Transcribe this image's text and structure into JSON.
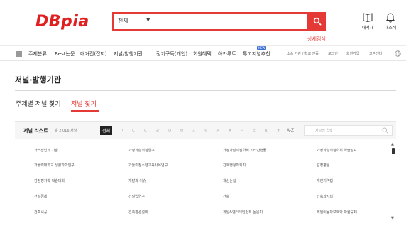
{
  "header": {
    "logo": "DBpia",
    "search": {
      "scope": "전체",
      "placeholder": ""
    },
    "advanced_search": "상세검색",
    "utils": [
      {
        "icon": "book-icon",
        "label": "내서재"
      },
      {
        "icon": "bell-icon",
        "label": "내소식"
      }
    ]
  },
  "nav": {
    "items": [
      "주제분류",
      "Best논문",
      "매거진(잡지)",
      "저널/발행기관",
      "정기구독(개인)",
      "회원혜택",
      "아카루트",
      "투고저널추천"
    ],
    "new_badge": "NEW",
    "small_links": [
      "소속 기관 / 학교 인증",
      "로그인",
      "회원가입",
      "고객센터"
    ]
  },
  "page": {
    "title": "저널·발행기관",
    "tabs": [
      "주제별 저널 찾기",
      "저널 찾기"
    ]
  },
  "journal_list": {
    "title": "저널 리스트",
    "count": "총 2,016 저널",
    "filters": [
      "전체",
      "ㄱ",
      "ㄴ",
      "ㄷ",
      "ㄹ",
      "ㅁ",
      "ㅂ",
      "ㅅ",
      "ㅇ",
      "ㅈ",
      "ㅊ",
      "ㅋ",
      "ㅌ",
      "ㅍ",
      "ㅎ",
      "A-Z"
    ],
    "search_placeholder": "저널명 입력",
    "rows": [
      [
        "가스산업과 기술",
        "가정과삶의질연구",
        "가정과삶의질학회 기타간행물",
        "가정과삶의질학회 학술발표..."
      ],
      [
        "가톨릭대학교 생활과학연구...",
        "가톨릭청소년교육사목연구",
        "간호행정학회지",
        "감정평론"
      ],
      [
        "감정평가학 학술대회",
        "개발과 이슈",
        "개신논집",
        "개인지역법"
      ],
      [
        "건설경제",
        "건설법연구",
        "건축",
        "건축과사회"
      ],
      [
        "건축시공",
        "건축환경설비",
        "게임&엔터테인먼트 논문지",
        "게임이용자보호와 자율규제"
      ]
    ]
  },
  "colors": {
    "brand": "#e53935",
    "accent_blue": "#3b6fd6"
  }
}
